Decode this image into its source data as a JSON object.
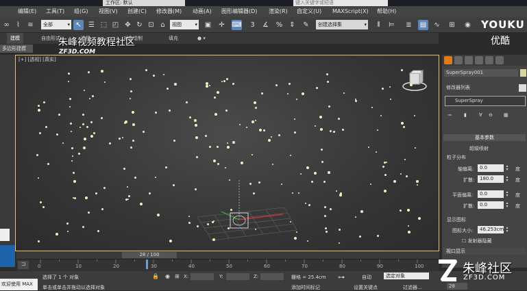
{
  "title": {
    "doc_tab": "工作区: 默认",
    "search_placeholder": "键入关键字或短语"
  },
  "menu": [
    "编辑(E)",
    "工具(T)",
    "组(G)",
    "视图(V)",
    "创建(C)",
    "修改器(M)",
    "动画(A)",
    "图形编辑器(D)",
    "渲染(R)",
    "自定义(U)",
    "MAXScript(X)",
    "帮助(H)"
  ],
  "toolbar": {
    "filter": "全部",
    "refcoord": "视图",
    "selection_set": "创建选择集"
  },
  "ribbon": {
    "tabs": [
      "建模",
      "自由形式",
      "选择",
      "对象绘制",
      "填充"
    ],
    "sub": "多边形建模"
  },
  "viewport": {
    "label": "[+] [透视] [真实]"
  },
  "watermark": {
    "cn": "朱峰视频教程社区",
    "en": "ZF3D.COM"
  },
  "logos": {
    "youku": "YOUKU",
    "youku_cn": "优酷",
    "brand_cn": "朱峰社区",
    "brand_en": "ZF3D.COM"
  },
  "command_panel": {
    "object_name": "SuperSpray001",
    "modifier_list": "修改器列表",
    "stack_item": "SuperSpray",
    "rollout_basic": "基本参数",
    "emitter_title": "超级喷射",
    "particle_distribution": "粒子分布",
    "axis_offset_label": "轴偏离:",
    "axis_offset_value": "0.0",
    "spread1_label": "扩散:",
    "spread1_value": "180.0",
    "plane_offset_label": "平面偏离:",
    "plane_offset_value": "0.0",
    "spread2_label": "扩散:",
    "spread2_value": "0.0",
    "unit": "度",
    "display_icon": "显示图标",
    "icon_size_label": "图标大小:",
    "icon_size_value": "46.253cm",
    "hide_emitter": "发射器隐藏",
    "viewport_display": "视口显示"
  },
  "timeline": {
    "frame": "28 / 100",
    "ticks": [
      "0",
      "10",
      "20",
      "30",
      "40",
      "50",
      "60",
      "70",
      "80",
      "90",
      "100"
    ]
  },
  "status": {
    "maxscript": "欢迎使用 MAX",
    "line1": "选择了 1 个 对象",
    "line2": "单击或单击并拖动以选择对象",
    "x_label": "X:",
    "y_label": "Y:",
    "z_label": "Z:",
    "grid": "栅格 = 25.4cm",
    "add_tag": "添加时间标记",
    "auto": "自动",
    "selected_object": "选定对象",
    "set_key": "设置关键点",
    "filters": "过滤器...",
    "frame_field": "28"
  },
  "colors": {
    "viewport_border": "#e8c26d",
    "active_tool": "#5f86b8",
    "particle": "#f3f0c2"
  }
}
